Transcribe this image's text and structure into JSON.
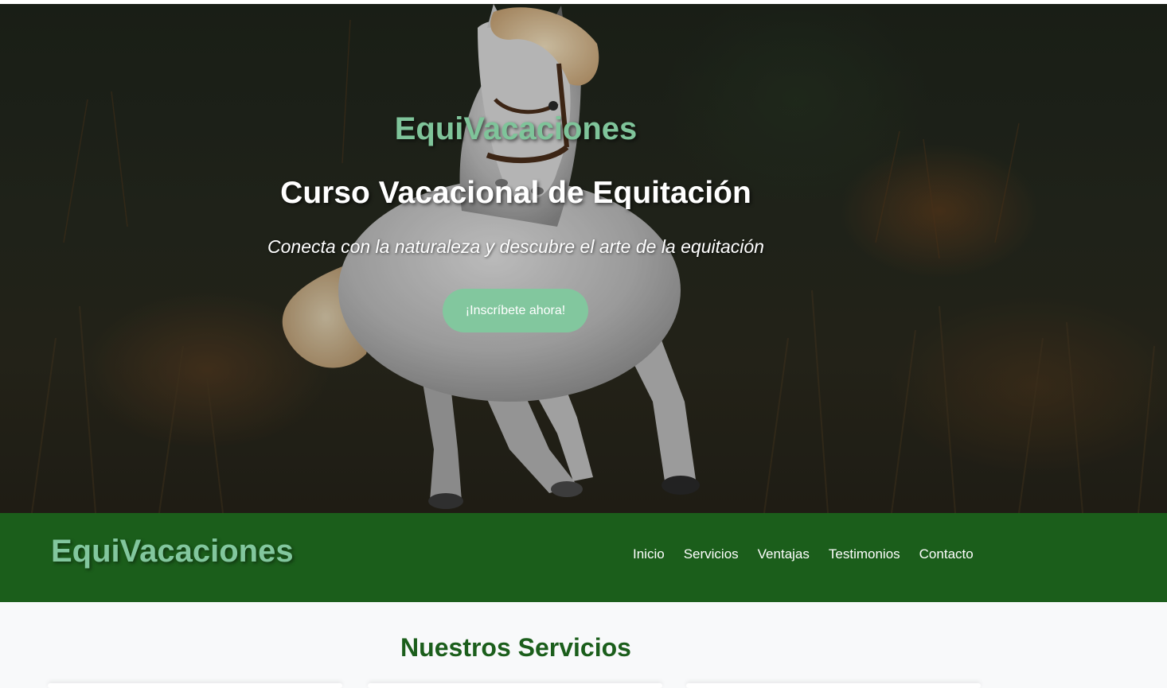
{
  "hero": {
    "brand": "EquiVacaciones",
    "title": "Curso Vacacional de Equitación",
    "subtitle": "Conecta con la naturaleza y descubre el arte de la equitación",
    "cta_label": "¡Inscríbete ahora!"
  },
  "navbar": {
    "brand": "EquiVacaciones",
    "links": [
      "Inicio",
      "Servicios",
      "Ventajas",
      "Testimonios",
      "Contacto"
    ]
  },
  "services": {
    "title": "Nuestros Servicios"
  },
  "colors": {
    "accent": "#82c79e",
    "nav_background": "#1b5e1b",
    "page_background": "#f8f9fa"
  }
}
